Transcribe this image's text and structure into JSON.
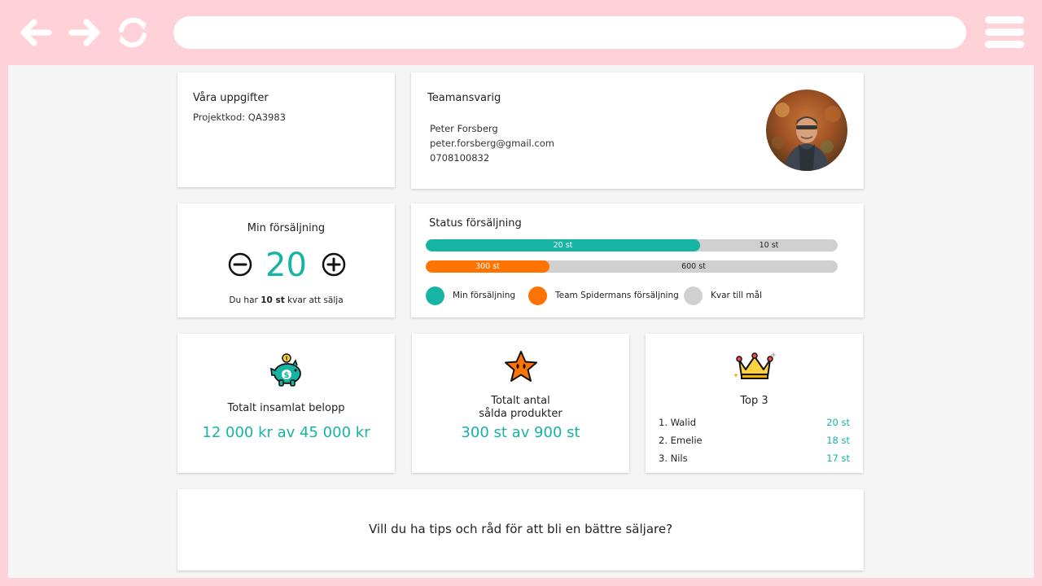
{
  "browser": {
    "address_value": "",
    "colors": {
      "chrome": "#ffd2da",
      "icons": "#ffffff"
    }
  },
  "uppgifter": {
    "title": "Våra uppgifter",
    "project_code": "Projektkod: QA3983"
  },
  "team": {
    "title": "Teamansvarig",
    "name": "Peter Forsberg",
    "email": "peter.forsberg@gmail.com",
    "phone": "0708100832"
  },
  "min_sales": {
    "title": "Min försäljning",
    "value": "20",
    "remaining_prefix": "Du har ",
    "remaining_value": "10 st",
    "remaining_suffix": " kvar att sälja",
    "accent": "#17b3a3"
  },
  "status": {
    "title": "Status försäljning",
    "bars": [
      {
        "filled_label": "20 st",
        "rest_label": "10 st",
        "fraction": 0.6667,
        "color": "#17b3a3"
      },
      {
        "filled_label": "300 st",
        "rest_label": "600 st",
        "fraction": 0.3,
        "color": "#ff7300"
      }
    ],
    "legend": [
      {
        "label": "Min försäljning",
        "color": "#17b3a3"
      },
      {
        "label": "Team Spidermans försäljning",
        "color": "#ff7300"
      },
      {
        "label": "Kvar till mål",
        "color": "#d0d0d0"
      }
    ]
  },
  "belopp": {
    "icon": "piggy-bank-icon",
    "title": "Totalt insamlat belopp",
    "value": "12 000 kr av 45 000 kr"
  },
  "produkter": {
    "icon": "star-icon",
    "title_line1": "Totalt antal",
    "title_line2": "sålda produkter",
    "value": "300 st av 900 st"
  },
  "top": {
    "icon": "crown-icon",
    "title": "Top 3",
    "rows": [
      {
        "name": "1. Walid",
        "value": "20 st"
      },
      {
        "name": "2. Emelie",
        "value": "18 st"
      },
      {
        "name": "3. Nils",
        "value": "17 st"
      }
    ]
  },
  "tips": {
    "text": "Vill du ha tips och råd för att bli en bättre säljare?"
  }
}
